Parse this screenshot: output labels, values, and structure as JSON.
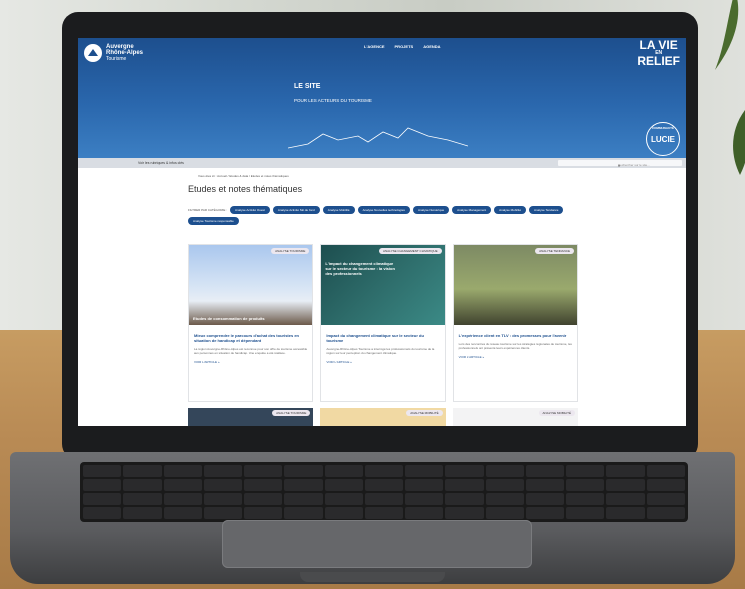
{
  "site": {
    "logo": {
      "line1": "Auvergne",
      "line2": "Rhône-Alpes",
      "line3": "Tourisme"
    },
    "nav": [
      "L'AGENCE",
      "PROJETS",
      "AGENDA"
    ],
    "brand": [
      "LA VIE",
      "EN",
      "RELIEF"
    ],
    "hero_title": "LE SITE",
    "hero_subtitle": "POUR LES ACTEURS DU TOURISME",
    "lucie": {
      "top": "COMMUNAUTÉ",
      "label": "LUCIE"
    },
    "sitebar_label": "Voir les rubriques & infos clés",
    "search_placeholder": "Rechercher sur le site...",
    "breadcrumb": "Vous êtes ici : Accueil / Etudes & data / Etudes et notes thématiques",
    "page_title": "Etudes et notes thématiques",
    "filter_label": "FILTRER PAR CATÉGORIE :",
    "tags": [
      "Analyse Activité Ouest",
      "Analyse Activité Ski de fond",
      "Analyse Mobilité",
      "Analyse Nouvelles technologies",
      "Analyse Numérique",
      "Analyse Management",
      "Analyse Mobilité",
      "Analyse Tendance",
      "Analyse Tourisme responsable"
    ],
    "cards": [
      {
        "badge": "ANALYSE TOURISME",
        "overlay": "Etudes de consommation de produits",
        "title": "Mieux comprendre le parcours d'achat des touristes en situation de handicap et dépendant",
        "text": "La région Auvergne-Rhône-Alpes est reconnue pour son offre de tourisme accessible aux personnes en situation de handicap. Une enquête a été réalisée.",
        "link": "VOIR L'ARTICLE »"
      },
      {
        "badge": "ANALYSE CHANGEMENT CLIMATIQUE",
        "overlay": "L'impact du changement climatique sur le secteur du tourisme : la vision des professionnels",
        "title": "Impact du changement climatique sur le secteur du tourisme",
        "text": "Auvergne-Rhône-Alpes Tourisme a interrogé les professionnels du tourisme de la région sur leur perception du changement climatique.",
        "link": "VOIR L'ARTICLE »"
      },
      {
        "badge": "ANALYSE TENDANCE",
        "overlay": "",
        "title": "L'expérience client en TLV : des promesses pour l'avenir",
        "text": "Lors des rencontres du réseau tourisme sur les stratégies régionales de tourisme, les professionnels ont présenté leurs expériences clients.",
        "link": "VOIR L'ARTICLE »"
      }
    ],
    "bottom_badges": [
      "ANALYSE TOURISME",
      "ANALYSE MOBILITÉ",
      "ANALYSE MOBILITÉ"
    ]
  }
}
